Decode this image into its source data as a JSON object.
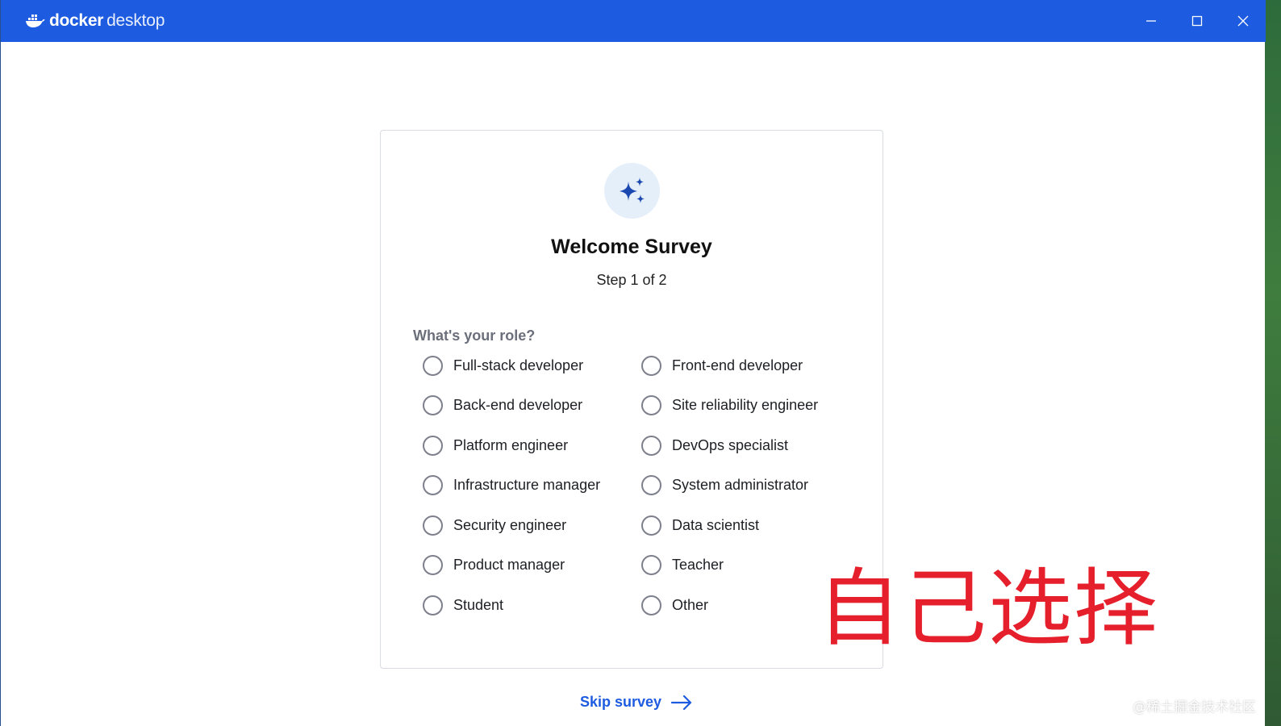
{
  "window": {
    "brand_bold": "docker",
    "brand_light": "desktop",
    "controls": [
      "minimize-icon",
      "maximize-icon",
      "close-icon"
    ]
  },
  "colors": {
    "titlebar": "#1d5be0",
    "accent": "#1d5be0",
    "overlay_text": "#e5202c"
  },
  "survey": {
    "icon": "sparkles-icon",
    "title": "Welcome Survey",
    "step": "Step 1 of 2",
    "question": "What's your role?",
    "options": [
      {
        "label": "Full-stack developer",
        "selected": false
      },
      {
        "label": "Front-end developer",
        "selected": false
      },
      {
        "label": "Back-end developer",
        "selected": false
      },
      {
        "label": "Site reliability engineer",
        "selected": false
      },
      {
        "label": "Platform engineer",
        "selected": false
      },
      {
        "label": "DevOps specialist",
        "selected": false
      },
      {
        "label": "Infrastructure manager",
        "selected": false
      },
      {
        "label": "System administrator",
        "selected": false
      },
      {
        "label": "Security engineer",
        "selected": false
      },
      {
        "label": "Data scientist",
        "selected": false
      },
      {
        "label": "Product manager",
        "selected": false
      },
      {
        "label": "Teacher",
        "selected": false
      },
      {
        "label": "Student",
        "selected": false
      },
      {
        "label": "Other",
        "selected": false
      }
    ],
    "skip_label": "Skip survey"
  },
  "overlay": {
    "annotation": "自己选择",
    "watermark": "@稀土掘金技术社区"
  }
}
